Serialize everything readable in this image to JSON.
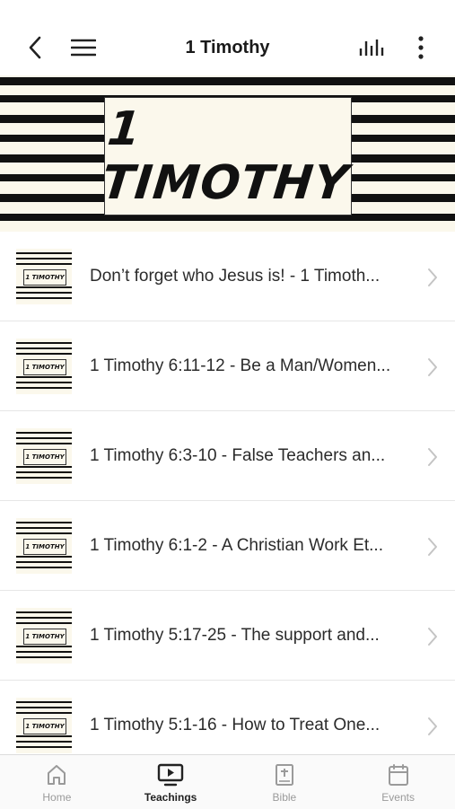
{
  "header": {
    "title": "1 Timothy"
  },
  "banner": {
    "text": "1 TIMOTHY"
  },
  "thumbnail": {
    "text": "1 TIMOTHY"
  },
  "items": [
    {
      "title": "Don’t forget who Jesus is! - 1 Timoth..."
    },
    {
      "title": "1 Timothy 6:11-12 - Be a Man/Women..."
    },
    {
      "title": "1 Timothy 6:3-10 - False Teachers an..."
    },
    {
      "title": "1 Timothy 6:1-2 - A Christian Work Et..."
    },
    {
      "title": "1 Timothy 5:17-25 - The support and..."
    },
    {
      "title": "1 Timothy 5:1-16 - How to Treat One..."
    }
  ],
  "tabs": [
    {
      "label": "Home",
      "icon": "home-icon",
      "active": false
    },
    {
      "label": "Teachings",
      "icon": "play-screen-icon",
      "active": true
    },
    {
      "label": "Bible",
      "icon": "bible-icon",
      "active": false
    },
    {
      "label": "Events",
      "icon": "calendar-icon",
      "active": false
    }
  ],
  "colors": {
    "banner_background": "#fbf8ec",
    "stripe": "#111111",
    "active_tab": "#222222",
    "inactive_tab": "#9a9a9a"
  }
}
